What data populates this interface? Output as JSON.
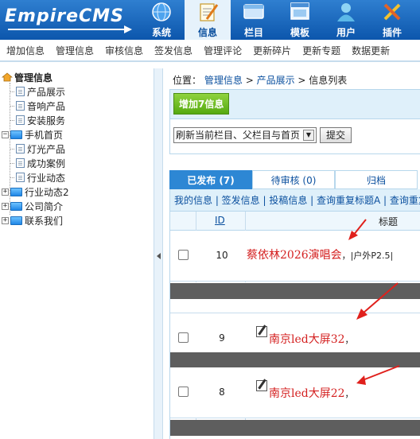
{
  "logo": {
    "text": "EmpireCMS"
  },
  "topnav": [
    {
      "label": "系统",
      "icon": "globe-icon",
      "active": false
    },
    {
      "label": "信息",
      "icon": "notepad-icon",
      "active": true
    },
    {
      "label": "栏目",
      "icon": "panel-icon",
      "active": false
    },
    {
      "label": "模板",
      "icon": "window-icon",
      "active": false
    },
    {
      "label": "用户",
      "icon": "user-icon",
      "active": false
    },
    {
      "label": "插件",
      "icon": "tools-icon",
      "active": false
    }
  ],
  "submenu": [
    "增加信息",
    "管理信息",
    "审核信息",
    "签发信息",
    "管理评论",
    "更新碎片",
    "更新专题",
    "数据更新"
  ],
  "tree": {
    "root": "管理信息",
    "items": [
      {
        "label": "产品展示",
        "type": "doc"
      },
      {
        "label": "音响产品",
        "type": "doc"
      },
      {
        "label": "安装服务",
        "type": "doc"
      },
      {
        "label": "手机首页",
        "type": "folder-open"
      },
      {
        "label": "灯光产品",
        "type": "doc"
      },
      {
        "label": "成功案例",
        "type": "doc"
      },
      {
        "label": "行业动态",
        "type": "doc"
      },
      {
        "label": "行业动态2",
        "type": "folder"
      },
      {
        "label": "公司简介",
        "type": "folder"
      },
      {
        "label": "联系我们",
        "type": "folder"
      }
    ]
  },
  "breadcrumb": {
    "prefix": "位置：",
    "link1": "管理信息",
    "sep1": " > ",
    "link2": "产品展示",
    "sep2": " > ",
    "current": "信息列表"
  },
  "add_button": "增加7信息",
  "refresh_select": "刷新当前栏目、父栏目与首页",
  "submit_button": "提交",
  "tabs": [
    {
      "label": "已发布 (7)",
      "active": true
    },
    {
      "label": "待审核 (0)",
      "active": false
    },
    {
      "label": "归档",
      "active": false
    }
  ],
  "links": "我的信息 | 签发信息 | 投稿信息 | 查询重复标题A | 查询重复",
  "columns": {
    "id": "ID",
    "title": "标题"
  },
  "rows": [
    {
      "id": "10",
      "title": "蔡依林2026演唱会",
      "suffix": "，|户外P2.5|"
    },
    {
      "id": "9",
      "title": "南京led大屏32",
      "suffix": "，"
    },
    {
      "id": "8",
      "title": "南京led大屏22",
      "suffix": "，"
    }
  ],
  "colors": {
    "header": "#0c56ac",
    "accent": "#2d87d4",
    "title_red": "#d42020",
    "add_green": "#55a90f"
  }
}
